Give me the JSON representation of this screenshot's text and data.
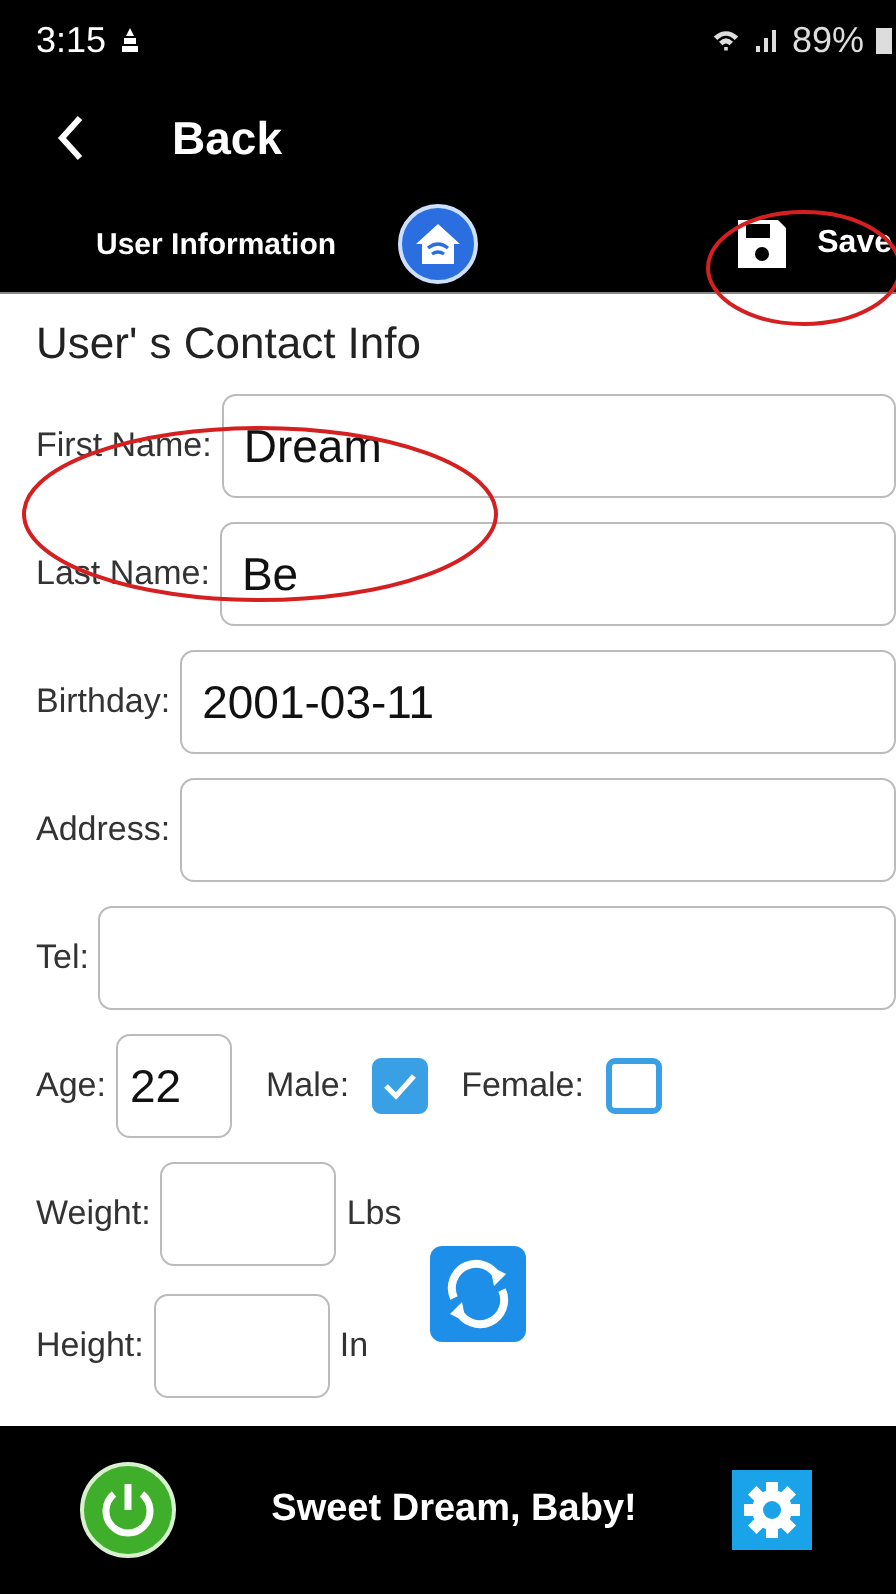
{
  "status_bar": {
    "time": "3:15",
    "battery": "89%"
  },
  "header": {
    "back_label": "Back"
  },
  "toolbar": {
    "title": "User Information",
    "save_label": "Save"
  },
  "form": {
    "heading": "User' s Contact Info",
    "fields": [
      {
        "label": "First Name:",
        "value": "Dream"
      },
      {
        "label": "Last Name:",
        "value": "Be"
      },
      {
        "label": "Birthday:",
        "value": "2001-03-11"
      },
      {
        "label": "Address:"
      },
      {
        "label": "Tel:"
      }
    ],
    "age": {
      "label": "Age:",
      "value": "22"
    },
    "genders": [
      {
        "label": "Male:",
        "checked": true
      },
      {
        "label": "Female:",
        "checked": false
      }
    ],
    "measures": [
      {
        "label": "Weight:",
        "unit": "Lbs"
      },
      {
        "label": "Height:",
        "unit": "In"
      }
    ]
  },
  "footer": {
    "title": "Sweet Dream, Baby!"
  }
}
